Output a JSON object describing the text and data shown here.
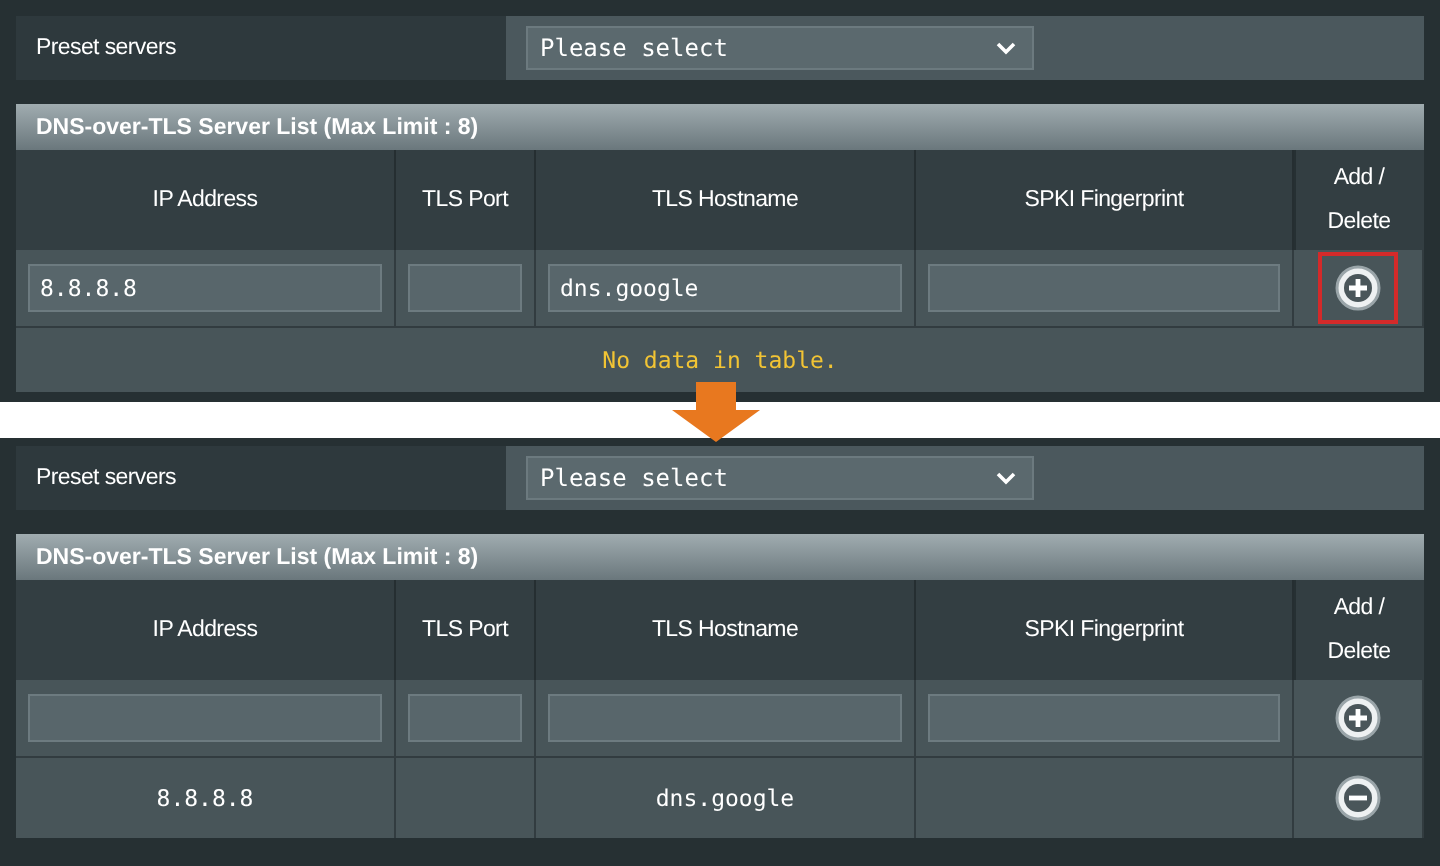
{
  "panels": [
    {
      "preset": {
        "label": "Preset servers",
        "value": "Please select"
      },
      "list_title": "DNS-over-TLS Server List (Max Limit : 8)",
      "columns": [
        "IP Address",
        "TLS Port",
        "TLS Hostname",
        "SPKI Fingerprint",
        "Add / Delete"
      ],
      "input_row": {
        "ip": "8.8.8.8",
        "hostname": "dns.google",
        "add_highlighted": true
      },
      "empty_message": "No data in table."
    },
    {
      "preset": {
        "label": "Preset servers",
        "value": "Please select"
      },
      "list_title": "DNS-over-TLS Server List (Max Limit : 8)",
      "columns": [
        "IP Address",
        "TLS Port",
        "TLS Hostname",
        "SPKI Fingerprint",
        "Add / Delete"
      ],
      "input_row": {
        "add_highlighted": false
      },
      "rows": [
        {
          "ip": "8.8.8.8",
          "hostname": "dns.google"
        }
      ]
    }
  ]
}
